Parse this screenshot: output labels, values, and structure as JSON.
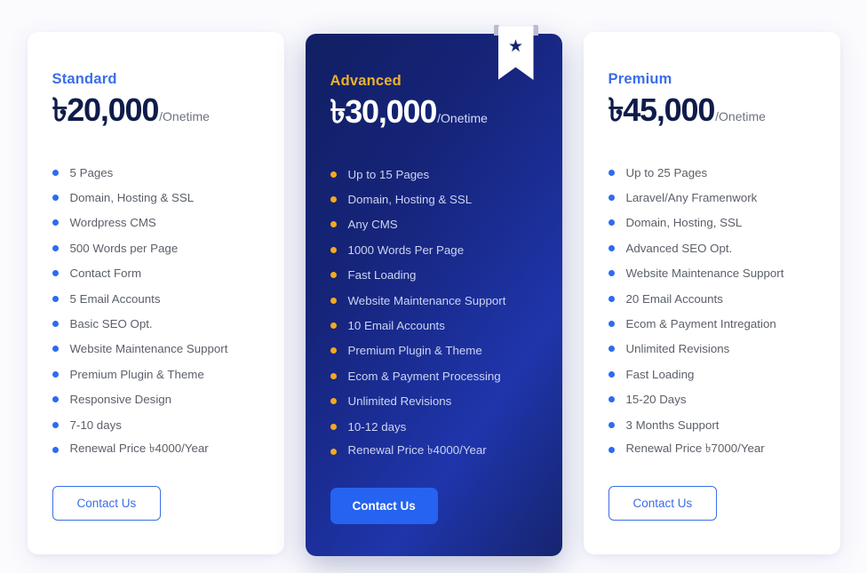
{
  "currency_symbol": "৳",
  "colors": {
    "page_background": "#fbfbfe",
    "accent_blue": "#3a6ee8",
    "bullet_blue": "#2d6bf0",
    "bullet_amber": "#f5a91c",
    "featured_name": "#edb12a",
    "price_dark": "#0f1c4a",
    "solid_button": "#2563f0",
    "ribbon_background": "#ffffff",
    "ribbon_star": "#16246f"
  },
  "plans": [
    {
      "name": "Standard",
      "price": "৳20,000",
      "period": "/Onetime",
      "featured": false,
      "bullet_style": "blue",
      "features": [
        "5 Pages",
        "Domain, Hosting & SSL",
        "Wordpress CMS",
        "500 Words per Page",
        "Contact Form",
        "5 Email Accounts",
        "Basic SEO Opt.",
        "Website Maintenance Support",
        "Premium Plugin & Theme",
        "Responsive Design",
        "7-10 days",
        "Renewal Price ৳4000/Year"
      ],
      "cta_label": "Contact Us",
      "cta_style": "outline"
    },
    {
      "name": "Advanced",
      "price": "৳30,000",
      "period": "/Onetime",
      "featured": true,
      "badge_icon": "star-icon",
      "badge_glyph": "★",
      "bullet_style": "amber",
      "features": [
        "Up to 15 Pages",
        "Domain, Hosting & SSL",
        "Any CMS",
        "1000 Words Per Page",
        "Fast Loading",
        "Website Maintenance Support",
        "10 Email Accounts",
        "Premium Plugin & Theme",
        "Ecom & Payment Processing",
        "Unlimited Revisions",
        "10-12 days",
        "Renewal Price ৳4000/Year"
      ],
      "cta_label": "Contact Us",
      "cta_style": "solid"
    },
    {
      "name": "Premium",
      "price": "৳45,000",
      "period": "/Onetime",
      "featured": false,
      "bullet_style": "blue",
      "features": [
        "Up to 25 Pages",
        "Laravel/Any Framenwork",
        "Domain, Hosting, SSL",
        "Advanced SEO Opt.",
        "Website Maintenance Support",
        "20 Email Accounts",
        "Ecom & Payment Intregation",
        "Unlimited Revisions",
        "Fast Loading",
        "15-20 Days",
        "3 Months Support",
        "Renewal Price ৳7000/Year"
      ],
      "cta_label": "Contact Us",
      "cta_style": "outline"
    }
  ]
}
